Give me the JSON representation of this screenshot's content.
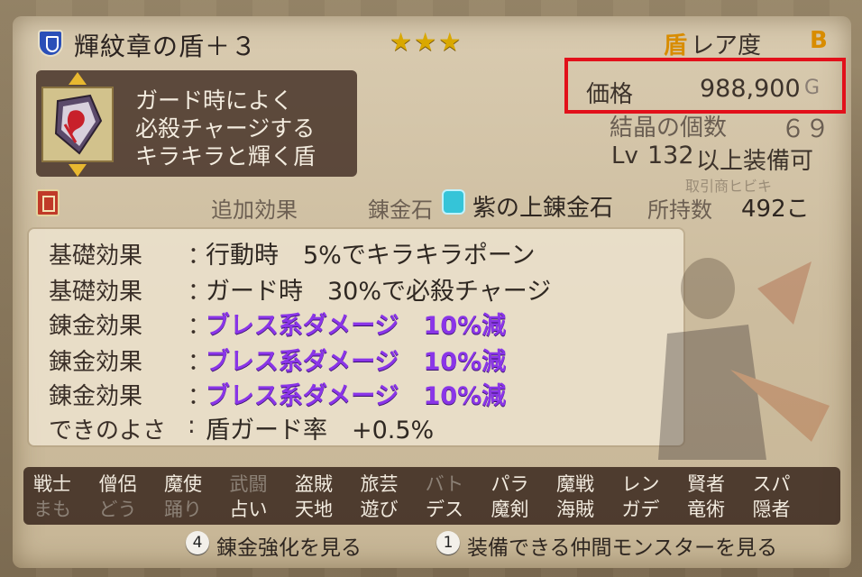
{
  "item": {
    "name": "輝紋章の盾＋３",
    "stars": "★★★",
    "rarity_kanji": "盾",
    "rarity_label": "レア度",
    "rarity_grade": "B",
    "description": [
      "ガード時によく",
      "必殺チャージする",
      "キラキラと輝く盾"
    ]
  },
  "stats": {
    "price_label": "価格",
    "price_value": "988,900",
    "price_unit": "G",
    "crystal_label": "結晶の個数",
    "crystal_value": "６９",
    "level_prefix": "Lv",
    "level_value": "132",
    "level_suffix": "以上装備可",
    "faded_text": "取引商ヒビキ"
  },
  "alchemy": {
    "extra_effects_label": "追加効果",
    "stone_label": "錬金石",
    "stone_name": "紫の上錬金石",
    "owned_label": "所持数",
    "owned_value": "492こ"
  },
  "effects": [
    {
      "label": "基礎効果",
      "colon": "：",
      "text": "行動時　5%でキラキラポーン"
    },
    {
      "label": "基礎効果",
      "colon": "：",
      "text": "ガード時　30%で必殺チャージ"
    },
    {
      "label": "錬金効果",
      "colon": "：",
      "text": "ブレス系ダメージ　10%減"
    },
    {
      "label": "錬金効果",
      "colon": "：",
      "text": "ブレス系ダメージ　10%減"
    },
    {
      "label": "錬金効果",
      "colon": "：",
      "text": "ブレス系ダメージ　10%減"
    },
    {
      "label": "できのよさ",
      "colon": ":",
      "text": "盾ガード率　+0.5%"
    }
  ],
  "jobs_top": [
    "戦士",
    "僧侶",
    "魔使",
    "武闘",
    "盗賊",
    "旅芸",
    "バト",
    "パラ",
    "魔戦",
    "レン",
    "賢者",
    "スパ"
  ],
  "jobs_bottom": [
    "まも",
    "どう",
    "踊り",
    "占い",
    "天地",
    "遊び",
    "デス",
    "魔剣",
    "海賊",
    "ガデ",
    "竜術",
    "隠者"
  ],
  "buttons": {
    "alchemy_num": "4",
    "alchemy_label": "錬金強化を見る",
    "monsters_num": "1",
    "monsters_label": "装備できる仲間モンスターを見る"
  },
  "colors": {
    "highlight_box": "#e2101a",
    "alchemy_effect": "#8a35e8",
    "rarity": "#d88c00",
    "stars": "#d9a800"
  },
  "icons": [
    "shield-icon",
    "book-icon",
    "gem-icon",
    "arrow-up-icon",
    "arrow-down-icon"
  ]
}
